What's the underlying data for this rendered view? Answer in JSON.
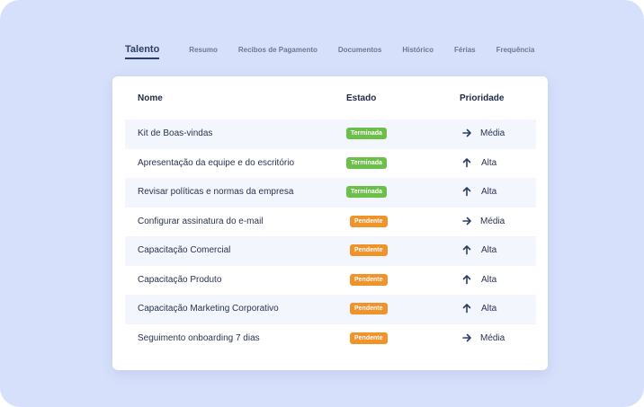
{
  "tabs": [
    {
      "label": "Talento",
      "active": true
    },
    {
      "label": "Resumo"
    },
    {
      "label": "Recibos de Pagamento"
    },
    {
      "label": "Documentos"
    },
    {
      "label": "Histórico"
    },
    {
      "label": "Férias"
    },
    {
      "label": "Frequência"
    }
  ],
  "table": {
    "headers": {
      "name": "Nome",
      "state": "Estado",
      "priority": "Prioridade"
    },
    "rows": [
      {
        "name": "Kit de Boas-vindas",
        "state": "Terminada",
        "priority": "Média",
        "priority_icon": "arrow-right-icon"
      },
      {
        "name": "Apresentação da equipe e do escritório",
        "state": "Terminada",
        "priority": "Alta",
        "priority_icon": "arrow-up-icon"
      },
      {
        "name": "Revisar políticas e normas da empresa",
        "state": "Terminada",
        "priority": "Alta",
        "priority_icon": "arrow-up-icon"
      },
      {
        "name": "Configurar assinatura do e-mail",
        "state": "Pendente",
        "priority": "Média",
        "priority_icon": "arrow-right-icon"
      },
      {
        "name": "Capacitação Comercial",
        "state": "Pendente",
        "priority": "Alta",
        "priority_icon": "arrow-up-icon"
      },
      {
        "name": "Capacitação Produto",
        "state": "Pendente",
        "priority": "Alta",
        "priority_icon": "arrow-up-icon"
      },
      {
        "name": "Capacitação Marketing Corporativo",
        "state": "Pendente",
        "priority": "Alta",
        "priority_icon": "arrow-up-icon"
      },
      {
        "name": "Seguimento onboarding 7 dias",
        "state": "Pendente",
        "priority": "Média",
        "priority_icon": "arrow-right-icon"
      }
    ]
  },
  "colors": {
    "background": "#d6e0fb",
    "accent": "#2e3d63",
    "done": "#6cc04a",
    "pending": "#f0932b",
    "row_shade": "#f3f6fd"
  }
}
